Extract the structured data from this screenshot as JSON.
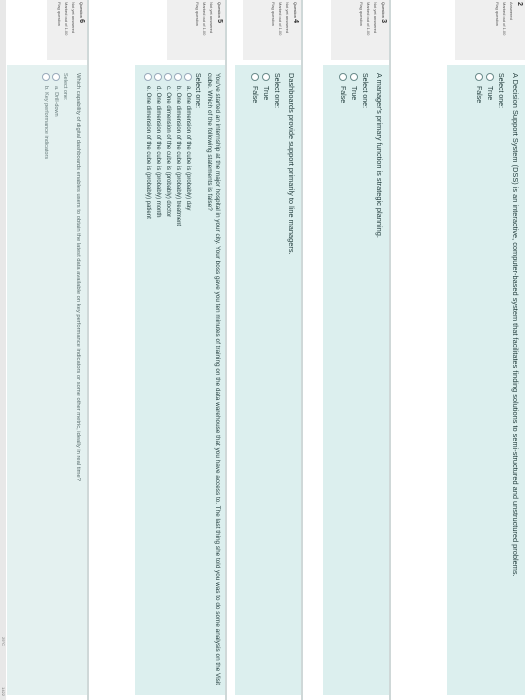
{
  "q2": {
    "number": "2",
    "status": "Answered",
    "mark": "Marked out of 1.00",
    "flag": "Flag question",
    "text": "A Decision Support System (DSS) is an interactive, computer-based system that facilitates finding solutions to semi-structured and unstructured problems.",
    "select_one": "Select one:",
    "options": [
      "True",
      "False"
    ]
  },
  "q3": {
    "label": "Question",
    "number": "3",
    "status": "Not yet answered",
    "mark": "Marked out of 1.00",
    "flag": "Flag question",
    "text": "A manager's primary function is strategic planning.",
    "select_one": "Select one:",
    "options": [
      "True",
      "False"
    ]
  },
  "q4": {
    "label": "Question",
    "number": "4",
    "status": "Not yet answered",
    "mark": "Marked out of 1.00",
    "flag": "Flag question",
    "text": "Dashboards provide support primarily to line managers.",
    "select_one": "Select one:",
    "options": [
      "True",
      "False"
    ]
  },
  "q5": {
    "label": "Question",
    "number": "5",
    "status": "Not yet answered",
    "mark": "Marked out of 1.00",
    "flag": "Flag question",
    "text": "You've started an internship at the major hospital in your city. Your boss gave you ten minutes of training on the data warehouse that you have access to. The last thing she told you was to do some analysis on the Visit cube. Which of the following statements is false?",
    "select_one": "Select one:",
    "options": [
      "a. One dimension of the cube is (probably) day",
      "b. One dimension of the cube is (probably) treatment",
      "c. One dimension of the cube is (probably) doctor",
      "d. One dimension of the cube is (probably) month",
      "e. One dimension of the cube is (probably) patient"
    ]
  },
  "q6": {
    "label": "Question",
    "number": "6",
    "status": "Not yet answered",
    "mark": "Marked out of 1.00",
    "flag": "Flag question",
    "text": "Which capability of digital dashboards enables users to obtain the latest data available on key performance indicators or some other metric, ideally in real time?",
    "select_one": "Select one:",
    "options": [
      "a. Drill-down",
      "b. Key performance indicators"
    ]
  },
  "footer": {
    "temp": "29°C",
    "time": "1422"
  }
}
